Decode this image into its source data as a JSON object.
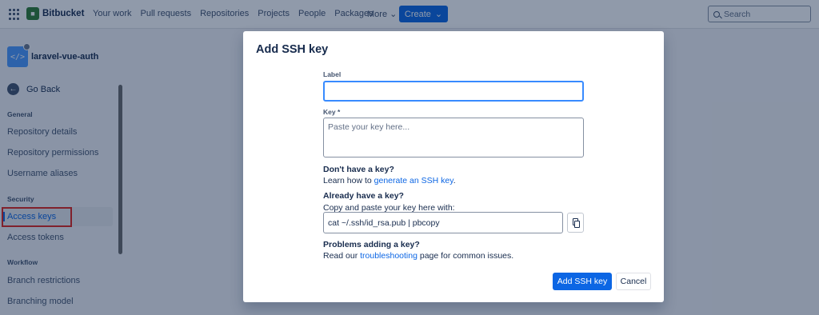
{
  "topnav": {
    "brand": "Bitbucket",
    "links": [
      "Your work",
      "Pull requests",
      "Repositories",
      "Projects",
      "People",
      "Packages"
    ],
    "more_label": "More",
    "create_label": "Create",
    "search_placeholder": "Search"
  },
  "sidebar": {
    "repo_name": "laravel-vue-auth",
    "go_back": "Go Back",
    "general_heading": "General",
    "general_items": [
      "Repository details",
      "Repository permissions",
      "Username aliases"
    ],
    "security_heading": "Security",
    "active_item": "Access keys",
    "security_items": [
      "Access tokens"
    ],
    "workflow_heading": "Workflow",
    "workflow_items": [
      "Branch restrictions",
      "Branching model"
    ]
  },
  "modal": {
    "title": "Add SSH key",
    "label_field_label": "Label",
    "label_value": "",
    "key_field_label": "Key *",
    "key_placeholder": "Paste your key here...",
    "no_key_heading": "Don't have a key?",
    "no_key_text_prefix": "Learn how to ",
    "no_key_link": "generate an SSH key",
    "no_key_text_suffix": ".",
    "have_key_heading": "Already have a key?",
    "have_key_text": "Copy and paste your key here with:",
    "command": "cat ~/.ssh/id_rsa.pub | pbcopy",
    "problems_heading": "Problems adding a key?",
    "problems_prefix": "Read our ",
    "problems_link": "troubleshooting",
    "problems_suffix": " page for common issues.",
    "submit_label": "Add SSH key",
    "cancel_label": "Cancel"
  },
  "colors": {
    "primary": "#0c66e4",
    "highlight_box": "#e2231a"
  }
}
